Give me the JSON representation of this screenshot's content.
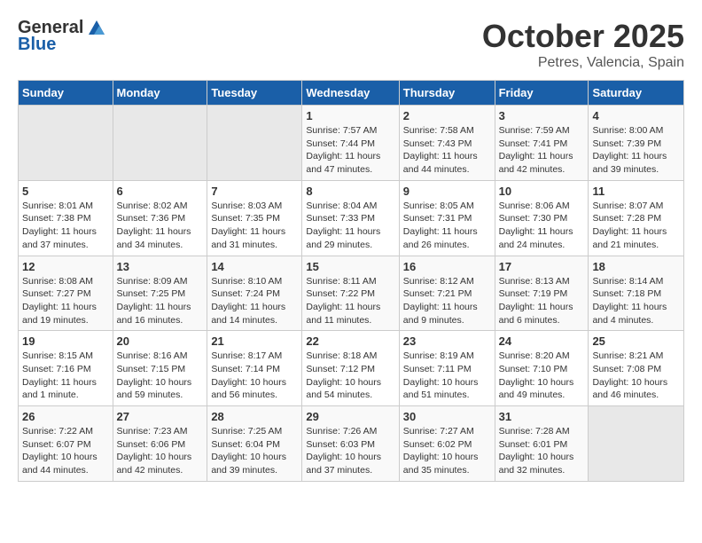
{
  "header": {
    "logo_general": "General",
    "logo_blue": "Blue",
    "month_title": "October 2025",
    "location": "Petres, Valencia, Spain"
  },
  "days_of_week": [
    "Sunday",
    "Monday",
    "Tuesday",
    "Wednesday",
    "Thursday",
    "Friday",
    "Saturday"
  ],
  "weeks": [
    [
      {
        "day": "",
        "content": ""
      },
      {
        "day": "",
        "content": ""
      },
      {
        "day": "",
        "content": ""
      },
      {
        "day": "1",
        "content": "Sunrise: 7:57 AM\nSunset: 7:44 PM\nDaylight: 11 hours and 47 minutes."
      },
      {
        "day": "2",
        "content": "Sunrise: 7:58 AM\nSunset: 7:43 PM\nDaylight: 11 hours and 44 minutes."
      },
      {
        "day": "3",
        "content": "Sunrise: 7:59 AM\nSunset: 7:41 PM\nDaylight: 11 hours and 42 minutes."
      },
      {
        "day": "4",
        "content": "Sunrise: 8:00 AM\nSunset: 7:39 PM\nDaylight: 11 hours and 39 minutes."
      }
    ],
    [
      {
        "day": "5",
        "content": "Sunrise: 8:01 AM\nSunset: 7:38 PM\nDaylight: 11 hours and 37 minutes."
      },
      {
        "day": "6",
        "content": "Sunrise: 8:02 AM\nSunset: 7:36 PM\nDaylight: 11 hours and 34 minutes."
      },
      {
        "day": "7",
        "content": "Sunrise: 8:03 AM\nSunset: 7:35 PM\nDaylight: 11 hours and 31 minutes."
      },
      {
        "day": "8",
        "content": "Sunrise: 8:04 AM\nSunset: 7:33 PM\nDaylight: 11 hours and 29 minutes."
      },
      {
        "day": "9",
        "content": "Sunrise: 8:05 AM\nSunset: 7:31 PM\nDaylight: 11 hours and 26 minutes."
      },
      {
        "day": "10",
        "content": "Sunrise: 8:06 AM\nSunset: 7:30 PM\nDaylight: 11 hours and 24 minutes."
      },
      {
        "day": "11",
        "content": "Sunrise: 8:07 AM\nSunset: 7:28 PM\nDaylight: 11 hours and 21 minutes."
      }
    ],
    [
      {
        "day": "12",
        "content": "Sunrise: 8:08 AM\nSunset: 7:27 PM\nDaylight: 11 hours and 19 minutes."
      },
      {
        "day": "13",
        "content": "Sunrise: 8:09 AM\nSunset: 7:25 PM\nDaylight: 11 hours and 16 minutes."
      },
      {
        "day": "14",
        "content": "Sunrise: 8:10 AM\nSunset: 7:24 PM\nDaylight: 11 hours and 14 minutes."
      },
      {
        "day": "15",
        "content": "Sunrise: 8:11 AM\nSunset: 7:22 PM\nDaylight: 11 hours and 11 minutes."
      },
      {
        "day": "16",
        "content": "Sunrise: 8:12 AM\nSunset: 7:21 PM\nDaylight: 11 hours and 9 minutes."
      },
      {
        "day": "17",
        "content": "Sunrise: 8:13 AM\nSunset: 7:19 PM\nDaylight: 11 hours and 6 minutes."
      },
      {
        "day": "18",
        "content": "Sunrise: 8:14 AM\nSunset: 7:18 PM\nDaylight: 11 hours and 4 minutes."
      }
    ],
    [
      {
        "day": "19",
        "content": "Sunrise: 8:15 AM\nSunset: 7:16 PM\nDaylight: 11 hours and 1 minute."
      },
      {
        "day": "20",
        "content": "Sunrise: 8:16 AM\nSunset: 7:15 PM\nDaylight: 10 hours and 59 minutes."
      },
      {
        "day": "21",
        "content": "Sunrise: 8:17 AM\nSunset: 7:14 PM\nDaylight: 10 hours and 56 minutes."
      },
      {
        "day": "22",
        "content": "Sunrise: 8:18 AM\nSunset: 7:12 PM\nDaylight: 10 hours and 54 minutes."
      },
      {
        "day": "23",
        "content": "Sunrise: 8:19 AM\nSunset: 7:11 PM\nDaylight: 10 hours and 51 minutes."
      },
      {
        "day": "24",
        "content": "Sunrise: 8:20 AM\nSunset: 7:10 PM\nDaylight: 10 hours and 49 minutes."
      },
      {
        "day": "25",
        "content": "Sunrise: 8:21 AM\nSunset: 7:08 PM\nDaylight: 10 hours and 46 minutes."
      }
    ],
    [
      {
        "day": "26",
        "content": "Sunrise: 7:22 AM\nSunset: 6:07 PM\nDaylight: 10 hours and 44 minutes."
      },
      {
        "day": "27",
        "content": "Sunrise: 7:23 AM\nSunset: 6:06 PM\nDaylight: 10 hours and 42 minutes."
      },
      {
        "day": "28",
        "content": "Sunrise: 7:25 AM\nSunset: 6:04 PM\nDaylight: 10 hours and 39 minutes."
      },
      {
        "day": "29",
        "content": "Sunrise: 7:26 AM\nSunset: 6:03 PM\nDaylight: 10 hours and 37 minutes."
      },
      {
        "day": "30",
        "content": "Sunrise: 7:27 AM\nSunset: 6:02 PM\nDaylight: 10 hours and 35 minutes."
      },
      {
        "day": "31",
        "content": "Sunrise: 7:28 AM\nSunset: 6:01 PM\nDaylight: 10 hours and 32 minutes."
      },
      {
        "day": "",
        "content": ""
      }
    ]
  ]
}
